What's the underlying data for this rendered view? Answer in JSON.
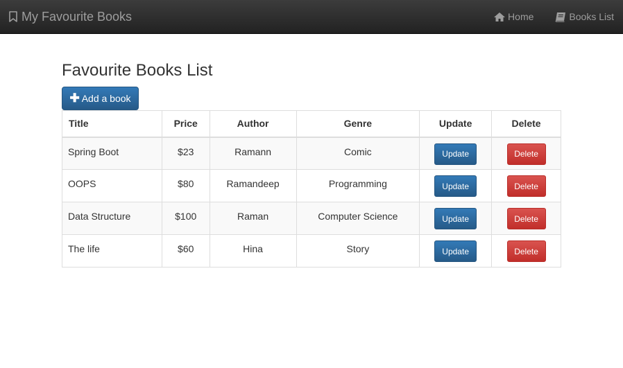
{
  "navbar": {
    "brand": "My Favourite Books",
    "links": [
      {
        "label": "Home",
        "icon": "home-icon"
      },
      {
        "label": "Books List",
        "icon": "book-icon"
      }
    ]
  },
  "main": {
    "title": "Favourite Books List",
    "add_button_label": "Add a book",
    "table": {
      "headers": [
        "Title",
        "Price",
        "Author",
        "Genre",
        "Update",
        "Delete"
      ],
      "rows": [
        {
          "title": "Spring Boot",
          "price": "$23",
          "author": "Ramann",
          "genre": "Comic",
          "update": "Update",
          "delete": "Delete"
        },
        {
          "title": "OOPS",
          "price": "$80",
          "author": "Ramandeep",
          "genre": "Programming",
          "update": "Update",
          "delete": "Delete"
        },
        {
          "title": "Data Structure",
          "price": "$100",
          "author": "Raman",
          "genre": "Computer Science",
          "update": "Update",
          "delete": "Delete"
        },
        {
          "title": "The life",
          "price": "$60",
          "author": "Hina",
          "genre": "Story",
          "update": "Update",
          "delete": "Delete"
        }
      ]
    }
  },
  "colors": {
    "navbar": "#222222",
    "nav_text": "#9d9d9d",
    "primary": "#337ab7",
    "danger": "#d9534f"
  }
}
